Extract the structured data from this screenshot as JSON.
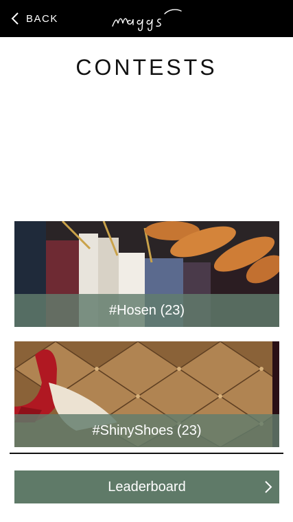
{
  "header": {
    "back_label": "BACK",
    "logo_text": "maggs"
  },
  "page": {
    "title": "CONTESTS"
  },
  "contests": [
    {
      "label": "#Hosen (23)",
      "image": "hanging-trousers-photo"
    },
    {
      "label": "#ShinyShoes (23)",
      "image": "red-shoe-on-tufted-leather-photo"
    }
  ],
  "leaderboard": {
    "label": "Leaderboard"
  },
  "colors": {
    "topbar": "#000000",
    "accent_green": "#5f7a68"
  }
}
